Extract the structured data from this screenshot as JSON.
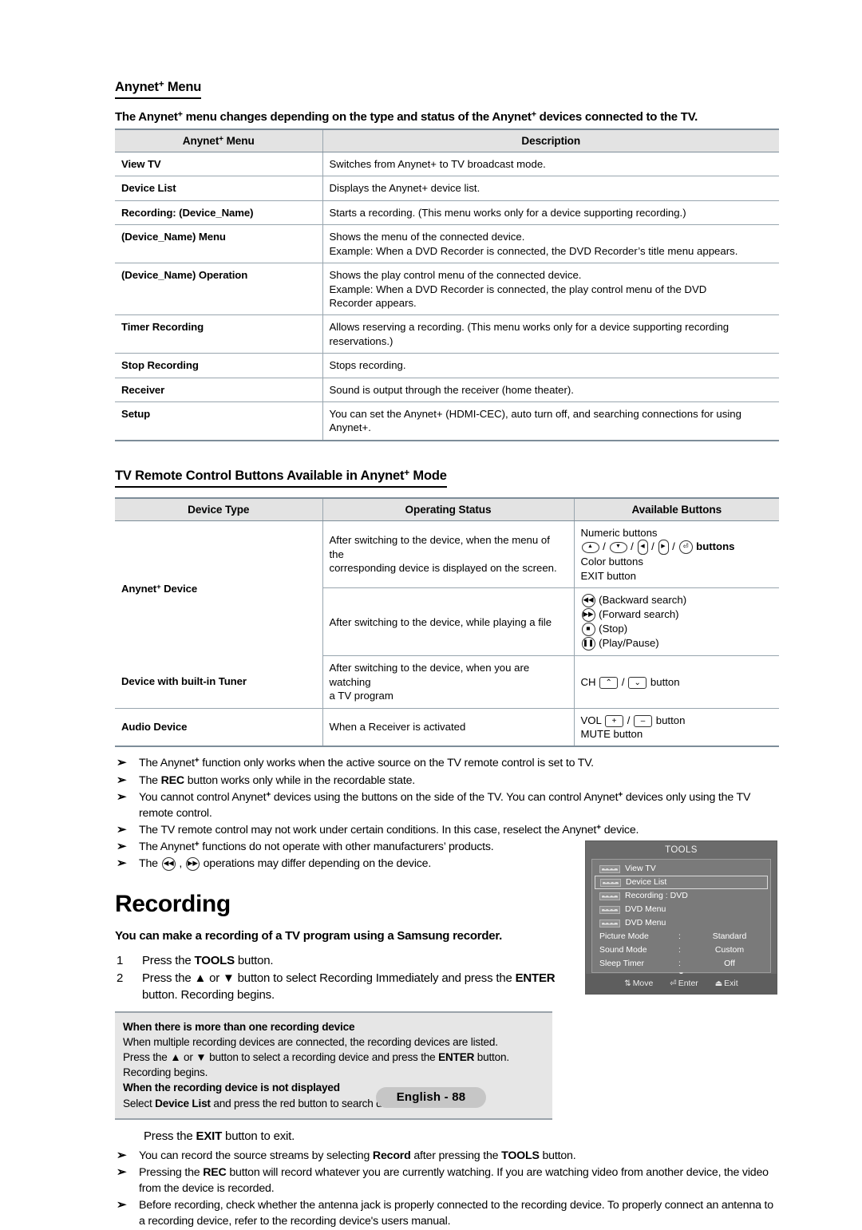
{
  "page": {
    "footer_label": "English - 88"
  },
  "section1": {
    "title_a": "Anynet",
    "title_b": " Menu",
    "lead_a": "The Anynet",
    "lead_b": " menu changes depending on the type and status of the Anynet",
    "lead_c": " devices connected to the TV.",
    "table": {
      "headers": {
        "col1_a": "Anynet",
        "col1_b": " Menu",
        "col2": "Description"
      },
      "rows": [
        {
          "name": "View TV",
          "lines": [
            "Switches from Anynet+ to TV broadcast mode."
          ]
        },
        {
          "name": "Device List",
          "lines": [
            "Displays the Anynet+ device list."
          ]
        },
        {
          "name": "Recording: (Device_Name)",
          "lines": [
            "Starts a recording. (This menu works only for a device supporting recording.)"
          ]
        },
        {
          "name": "(Device_Name) Menu",
          "lines": [
            "Shows the menu of the connected device.",
            "Example: When a DVD Recorder is connected, the DVD Recorder’s title menu appears."
          ]
        },
        {
          "name": "(Device_Name) Operation",
          "lines": [
            "Shows the play control menu of the connected device.",
            "Example: When a DVD Recorder is connected, the play control menu of the DVD",
            "Recorder appears."
          ]
        },
        {
          "name": "Timer Recording",
          "lines": [
            "Allows reserving a recording. (This menu works only for a device supporting recording",
            "reservations.)"
          ]
        },
        {
          "name": "Stop Recording",
          "lines": [
            "Stops recording."
          ]
        },
        {
          "name": "Receiver",
          "lines": [
            "Sound is output through the receiver (home theater)."
          ]
        },
        {
          "name": "Setup",
          "lines": [
            "You can set the Anynet+ (HDMI-CEC), auto turn off, and searching connections for using",
            "Anynet+."
          ]
        }
      ]
    }
  },
  "section2": {
    "title_a": "TV  Remote Control Buttons Available in Anynet",
    "title_b": " Mode",
    "table": {
      "headers": {
        "col1": "Device Type",
        "col2": "Operating Status",
        "col3": "Available Buttons"
      },
      "rows": [
        {
          "device_a": "Anynet",
          "device_b": " Device",
          "status_line1": "After switching to the device, when the menu of the",
          "status_line2": "corresponding device is displayed on the screen.",
          "buttons": {
            "l1": "Numeric buttons",
            "arrow_suffix": " buttons",
            "l3": "Color buttons",
            "l4": "EXIT button"
          }
        },
        {
          "status_line1": "After switching to the device, while playing a file",
          "buttons": {
            "b1": "(Backward search)",
            "b2": "(Forward search)",
            "b3": "(Stop)",
            "b4": "(Play/Pause)"
          }
        },
        {
          "device": "Device with built-in Tuner",
          "status_line1": "After switching to the device, when you are watching",
          "status_line2": "a TV program",
          "buttons": {
            "prefix": "CH",
            "suffix": "button"
          }
        },
        {
          "device": "Audio Device",
          "status_line1": "When a Receiver is activated",
          "buttons": {
            "prefix": "VOL",
            "suffix": "button",
            "mute": "MUTE button"
          }
        }
      ]
    },
    "notes": [
      {
        "parts": [
          {
            "t": "The Anynet",
            "b": false
          },
          {
            "t": "+",
            "sup": true
          },
          {
            "t": " function only works when the active source on the TV remote control is set to TV.",
            "b": false
          }
        ]
      },
      {
        "parts": [
          {
            "t": "The ",
            "b": false
          },
          {
            "t": "REC",
            "b": true
          },
          {
            "t": " button works only while in the recordable state.",
            "b": false
          }
        ]
      },
      {
        "parts": [
          {
            "t": "You cannot control Anynet",
            "b": false
          },
          {
            "t": "+",
            "sup": true
          },
          {
            "t": " devices using the buttons on the side of the TV. You can control Anynet",
            "b": false
          },
          {
            "t": "+",
            "sup": true
          },
          {
            "t": " devices only using the TV remote control.",
            "b": false
          }
        ]
      },
      {
        "parts": [
          {
            "t": "The TV remote control may not work under certain conditions. In this case, reselect the Anynet",
            "b": false
          },
          {
            "t": "+",
            "sup": true
          },
          {
            "t": " device.",
            "b": false
          }
        ]
      },
      {
        "parts": [
          {
            "t": "The Anynet",
            "b": false
          },
          {
            "t": "+",
            "sup": true
          },
          {
            "t": " functions do not operate with other manufacturers’ products.",
            "b": false
          }
        ]
      },
      {
        "parts": [
          {
            "t": "The ",
            "b": false
          },
          {
            "t": "@BACK@",
            "b": false
          },
          {
            "t": " , ",
            "b": false
          },
          {
            "t": "@FWD@",
            "b": false
          },
          {
            "t": " operations may differ depending on the device.",
            "b": false
          }
        ]
      }
    ]
  },
  "section3": {
    "heading": "Recording",
    "lead": "You can make a recording of a TV program using a Samsung recorder.",
    "steps": [
      {
        "num": "1",
        "parts": [
          {
            "t": "Press the ",
            "b": false
          },
          {
            "t": "TOOLS",
            "b": true
          },
          {
            "t": " button.",
            "b": false
          }
        ]
      },
      {
        "num": "2",
        "parts": [
          {
            "t": "Press the ▲ or ▼ button to select Recording Immediately and press the ",
            "b": false
          },
          {
            "t": "ENTER",
            "b": true
          },
          {
            "t": " button. Recording begins.",
            "b": false
          }
        ]
      }
    ],
    "notebox": [
      {
        "bold": true,
        "parts": [
          {
            "t": "When there is more than one recording device",
            "b": true
          }
        ]
      },
      {
        "bold": false,
        "parts": [
          {
            "t": "When multiple recording devices are connected, the recording devices are listed.",
            "b": false
          }
        ]
      },
      {
        "bold": false,
        "parts": [
          {
            "t": "Press the ▲ or ▼ button to select a recording device and press the ",
            "b": false
          },
          {
            "t": "ENTER",
            "b": true
          },
          {
            "t": " button.",
            "b": false
          }
        ]
      },
      {
        "bold": false,
        "parts": [
          {
            "t": "Recording begins.",
            "b": false
          }
        ]
      },
      {
        "bold": true,
        "parts": [
          {
            "t": "When the recording device is not displayed",
            "b": true
          }
        ]
      },
      {
        "bold": false,
        "parts": [
          {
            "t": "Select ",
            "b": false
          },
          {
            "t": "Device List",
            "b": true
          },
          {
            "t": " and press the red button to search devices.",
            "b": false
          }
        ]
      }
    ],
    "exit_line": [
      {
        "t": "Press the ",
        "b": false
      },
      {
        "t": "EXIT",
        "b": true
      },
      {
        "t": " button to exit.",
        "b": false
      }
    ],
    "notes": [
      {
        "parts": [
          {
            "t": "You can record the source streams by selecting ",
            "b": false
          },
          {
            "t": "Record",
            "b": true
          },
          {
            "t": " after pressing the ",
            "b": false
          },
          {
            "t": "TOOLS",
            "b": true
          },
          {
            "t": " button.",
            "b": false
          }
        ]
      },
      {
        "parts": [
          {
            "t": "Pressing the ",
            "b": false
          },
          {
            "t": "REC",
            "b": true
          },
          {
            "t": " button will record whatever you are currently watching. If you are watching video from another device, the video from the device is recorded.",
            "b": false
          }
        ]
      },
      {
        "parts": [
          {
            "t": "Before recording, check whether the antenna jack is properly connected to the recording device. To properly connect an antenna to a recording device, refer to the recording device's users manual.",
            "b": false
          }
        ]
      }
    ]
  },
  "osd": {
    "title": "TOOLS",
    "items": [
      {
        "type": "badge",
        "label": "View TV",
        "selected": false
      },
      {
        "type": "badge",
        "label": "Device List",
        "selected": true
      },
      {
        "type": "badge",
        "label": "Recording : DVD",
        "selected": false
      },
      {
        "type": "badge",
        "label": "DVD Menu",
        "selected": false
      },
      {
        "type": "badge",
        "label": "DVD Menu",
        "selected": false
      },
      {
        "type": "kv",
        "label": "Picture Mode",
        "colon": ":",
        "value": "Standard"
      },
      {
        "type": "kv",
        "label": "Sound Mode",
        "colon": ":",
        "value": "Custom"
      },
      {
        "type": "kv",
        "label": "Sleep Timer",
        "colon": ":",
        "value": "Off"
      }
    ],
    "caret": "▼",
    "footer": {
      "move": "Move",
      "enter": "Enter",
      "exit": "Exit"
    }
  },
  "colors": {
    "table_header_bg": "#e3e3e3",
    "table_rule": "#98a5ae",
    "note_bg": "#e6e6e6",
    "osd_bg": "#6b6b6b",
    "osd_panel": "#7a7a7a",
    "footer_pill": "#c6c6c6"
  }
}
